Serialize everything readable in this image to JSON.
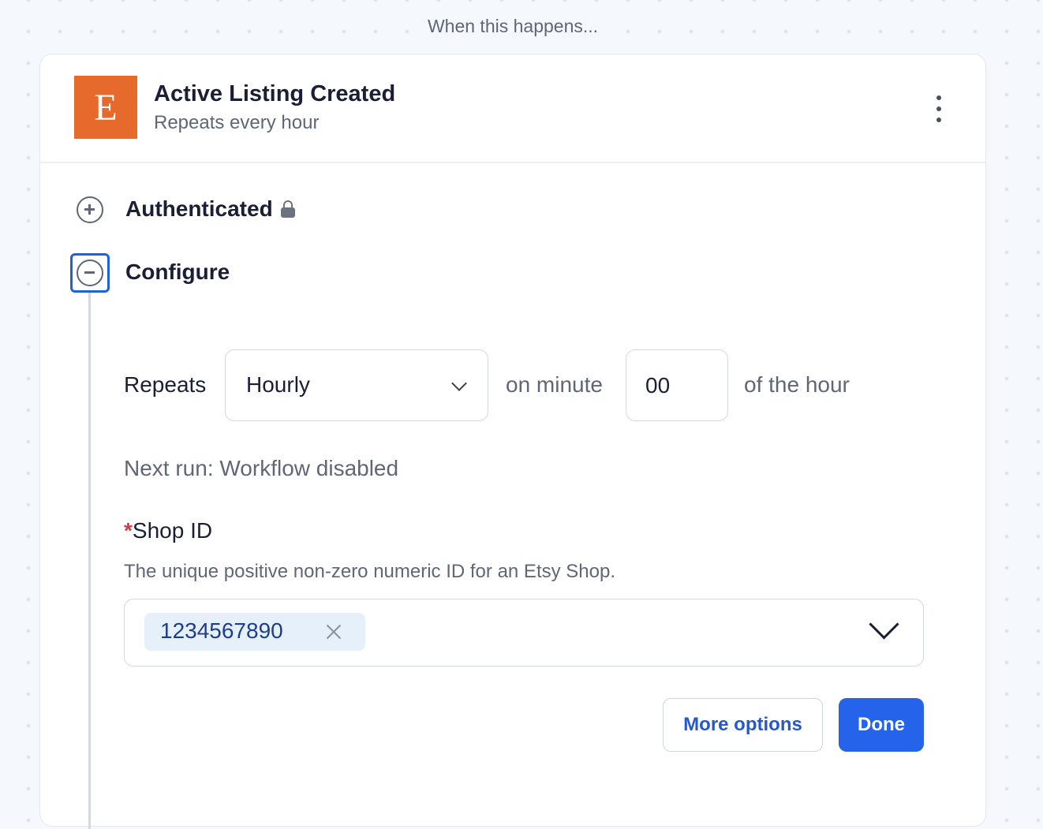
{
  "trigger_caption": "When this happens...",
  "trigger": {
    "app_logo_letter": "E",
    "title": "Active Listing Created",
    "subtitle": "Repeats every hour",
    "brand_color": "#e66a2c"
  },
  "steps": {
    "authenticated": {
      "label": "Authenticated",
      "icon": "lock-icon",
      "toggle_icon": "plus-circle-icon"
    },
    "configure": {
      "label": "Configure",
      "toggle_icon": "minus-circle-icon"
    }
  },
  "schedule": {
    "repeats_label": "Repeats",
    "frequency_value": "Hourly",
    "on_minute_label": "on minute",
    "minute_value": "00",
    "of_hour_label": "of the hour",
    "next_run": "Next run: Workflow disabled"
  },
  "shop_id": {
    "required_marker": "*",
    "label": "Shop ID",
    "help": "The unique positive non-zero numeric ID for an Etsy Shop.",
    "selected_value": "1234567890"
  },
  "actions": {
    "more_options": "More options",
    "done": "Done"
  },
  "colors": {
    "accent": "#2563eb",
    "focus": "#2060d8",
    "required": "#d63b3b"
  }
}
